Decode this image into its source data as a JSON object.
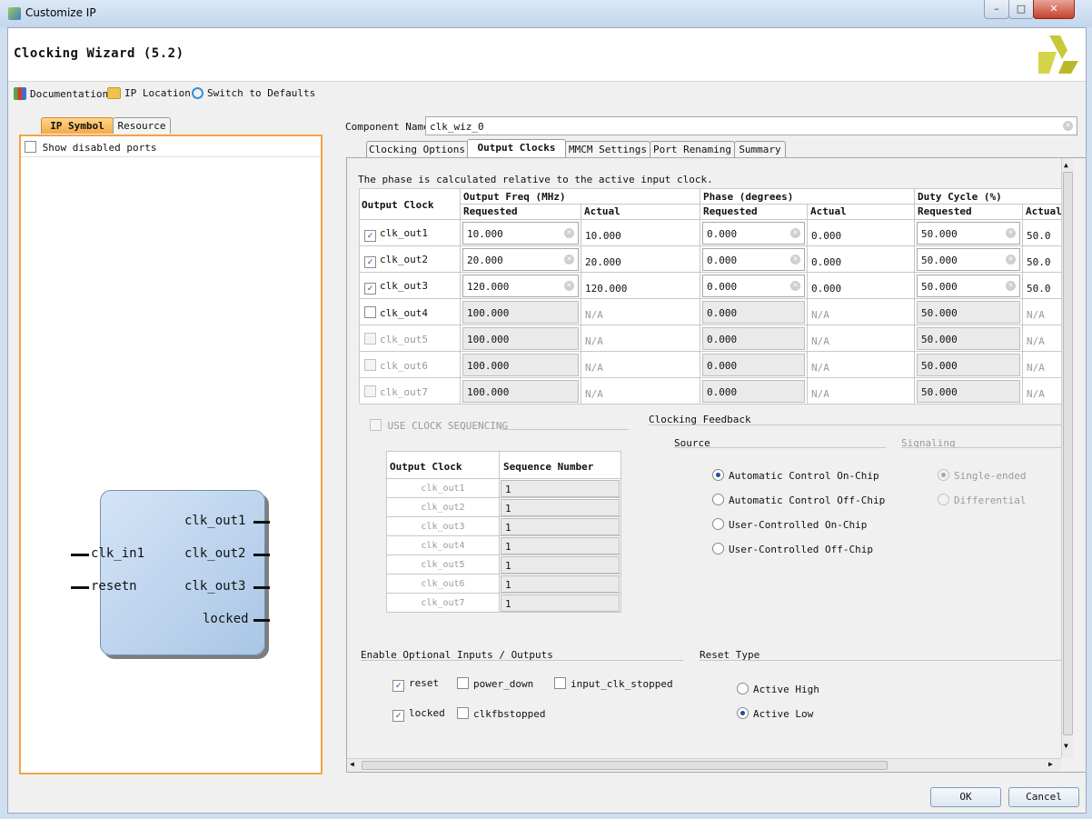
{
  "window": {
    "title": "Customize IP",
    "minimize": "–",
    "maximize": "□",
    "close": "✕"
  },
  "header": {
    "title": "Clocking Wizard (5.2)",
    "logo": "xilinx-logo-icon"
  },
  "toolbar": {
    "documentation": "Documentation",
    "ip_location": "IP Location",
    "switch_defaults": "Switch to Defaults"
  },
  "left": {
    "tabs": [
      "IP Symbol",
      "Resource"
    ],
    "show_disabled": "Show disabled ports",
    "symbol": {
      "inputs": [
        "clk_in1",
        "resetn"
      ],
      "outputs": [
        "clk_out1",
        "clk_out2",
        "clk_out3",
        "locked"
      ]
    }
  },
  "component": {
    "label": "Component Name",
    "value": "clk_wiz_0"
  },
  "tabs": [
    "Clocking Options",
    "Output Clocks",
    "MMCM Settings",
    "Port Renaming",
    "Summary"
  ],
  "note": "The phase is calculated relative to the active input clock.",
  "table": {
    "headers": {
      "output_clock": "Output Clock",
      "freq": "Output Freq (MHz)",
      "phase": "Phase (degrees)",
      "duty": "Duty Cycle (%)",
      "requested": "Requested",
      "actual": "Actual"
    },
    "rows": [
      {
        "name": "clk_out1",
        "checked": true,
        "freq_req": "10.000",
        "freq_act": "10.000",
        "phase_req": "0.000",
        "phase_act": "0.000",
        "duty_req": "50.000",
        "duty_act": "50.0"
      },
      {
        "name": "clk_out2",
        "checked": true,
        "freq_req": "20.000",
        "freq_act": "20.000",
        "phase_req": "0.000",
        "phase_act": "0.000",
        "duty_req": "50.000",
        "duty_act": "50.0"
      },
      {
        "name": "clk_out3",
        "checked": true,
        "freq_req": "120.000",
        "freq_act": "120.000",
        "phase_req": "0.000",
        "phase_act": "0.000",
        "duty_req": "50.000",
        "duty_act": "50.0"
      },
      {
        "name": "clk_out4",
        "checked": false,
        "freq_req": "100.000",
        "freq_act": "N/A",
        "phase_req": "0.000",
        "phase_act": "N/A",
        "duty_req": "50.000",
        "duty_act": "N/A"
      },
      {
        "name": "clk_out5",
        "checked": false,
        "freq_req": "100.000",
        "freq_act": "N/A",
        "phase_req": "0.000",
        "phase_act": "N/A",
        "duty_req": "50.000",
        "duty_act": "N/A"
      },
      {
        "name": "clk_out6",
        "checked": false,
        "freq_req": "100.000",
        "freq_act": "N/A",
        "phase_req": "0.000",
        "phase_act": "N/A",
        "duty_req": "50.000",
        "duty_act": "N/A"
      },
      {
        "name": "clk_out7",
        "checked": false,
        "freq_req": "100.000",
        "freq_act": "N/A",
        "phase_req": "0.000",
        "phase_act": "N/A",
        "duty_req": "50.000",
        "duty_act": "N/A"
      }
    ]
  },
  "sequencing": {
    "label": "USE CLOCK SEQUENCING",
    "col1": "Output Clock",
    "col2": "Sequence Number",
    "rows": [
      {
        "name": "clk_out1",
        "seq": "1"
      },
      {
        "name": "clk_out2",
        "seq": "1"
      },
      {
        "name": "clk_out3",
        "seq": "1"
      },
      {
        "name": "clk_out4",
        "seq": "1"
      },
      {
        "name": "clk_out5",
        "seq": "1"
      },
      {
        "name": "clk_out6",
        "seq": "1"
      },
      {
        "name": "clk_out7",
        "seq": "1"
      }
    ]
  },
  "feedback": {
    "title": "Clocking Feedback",
    "source_label": "Source",
    "signaling_label": "Signaling",
    "sources": [
      "Automatic Control On-Chip",
      "Automatic Control Off-Chip",
      "User-Controlled On-Chip",
      "User-Controlled Off-Chip"
    ],
    "source_selected": 0,
    "signaling": [
      "Single-ended",
      "Differential"
    ],
    "signaling_selected": 0
  },
  "optional": {
    "title": "Enable Optional Inputs / Outputs",
    "items": [
      {
        "label": "reset",
        "checked": true
      },
      {
        "label": "power_down",
        "checked": false
      },
      {
        "label": "input_clk_stopped",
        "checked": false
      },
      {
        "label": "locked",
        "checked": true
      },
      {
        "label": "clkfbstopped",
        "checked": false
      }
    ]
  },
  "reset_type": {
    "title": "Reset Type",
    "options": [
      "Active High",
      "Active Low"
    ],
    "selected": 1
  },
  "buttons": {
    "ok": "OK",
    "cancel": "Cancel"
  },
  "colors": {
    "accent_orange": "#f3a24a",
    "symbol_fill": "#b9d1ec",
    "title_bar": "#c3d6ec"
  }
}
